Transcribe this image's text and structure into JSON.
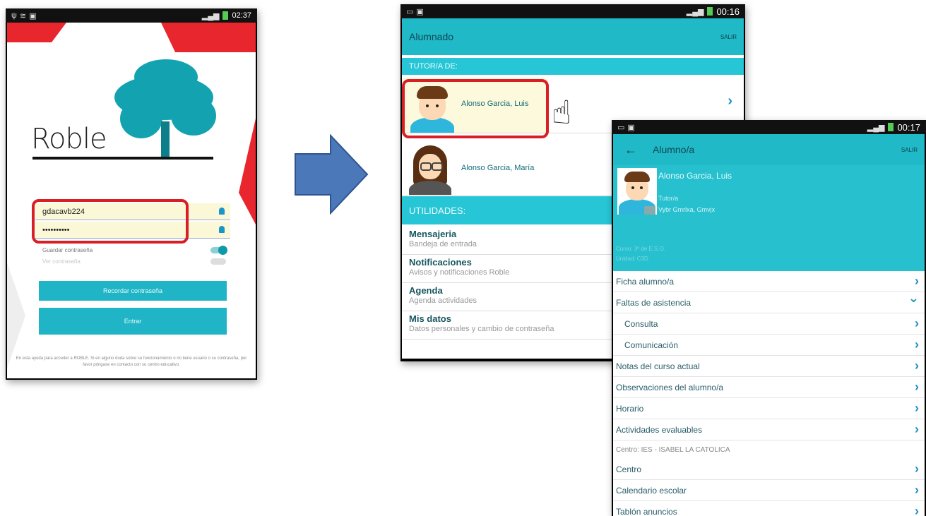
{
  "login": {
    "app_title": "Roble",
    "username_value": "gdacavb224",
    "password_value": "••••••••••",
    "save_password_label": "Guardar contraseña",
    "show_password_label": "Ver contraseña",
    "recover_button": "Recordar contraseña",
    "login_button": "Entrar",
    "footer": "En esta ayuda para acceder a ROBLE. Si en alguno duda sobre su funcionamiento o no tiene usuario o su contraseña, por favor póngase en contacto con su centro educativo.",
    "status_time": "02:37"
  },
  "alumnado": {
    "status_time": "00:16",
    "title": "Alumnado",
    "logout": "SALIR",
    "tutor_section": "TUTOR/A DE:",
    "students": [
      {
        "name": "Alonso Garcia, Luis"
      },
      {
        "name": "Alonso Garcia, María"
      }
    ],
    "utilities_section": "UTILIDADES:",
    "utilities": [
      {
        "title": "Mensajeria",
        "subtitle": "Bandeja de entrada"
      },
      {
        "title": "Notificaciones",
        "subtitle": "Avisos y notificaciones Roble"
      },
      {
        "title": "Agenda",
        "subtitle": "Agenda actividades"
      },
      {
        "title": "Mis datos",
        "subtitle": "Datos personales y cambio de contraseña"
      }
    ]
  },
  "alumno": {
    "status_time": "00:17",
    "title": "Alumno/a",
    "logout": "SALIR",
    "student_name": "Alonso Garcia, Luis",
    "tutor_label": "Tutor/a",
    "tutor_name": "Vybr Gmrlxa, Gmvjx",
    "course": "Curso: 3º de E.S.O.",
    "unit": "Unidad: C3D",
    "menu": [
      {
        "label": "Ficha alumno/a",
        "chevron": "›"
      },
      {
        "label": "Faltas de asistencia",
        "chevron": "⌄"
      },
      {
        "label": "Consulta",
        "chevron": "›"
      },
      {
        "label": "Comunicación",
        "chevron": "›"
      },
      {
        "label": "Notas del curso actual",
        "chevron": "›"
      },
      {
        "label": "Observaciones del alumno/a",
        "chevron": "›"
      },
      {
        "label": "Horario",
        "chevron": "›"
      },
      {
        "label": "Actividades evaluables",
        "chevron": "›"
      }
    ],
    "centro_line": "Centro: IES - ISABEL LA CATOLICA",
    "centro_menu": [
      {
        "label": "Centro",
        "chevron": "›"
      },
      {
        "label": "Calendario escolar",
        "chevron": "›"
      },
      {
        "label": "Tablón anuncios",
        "chevron": "›"
      }
    ]
  },
  "colors": {
    "teal": "#1fb9c8",
    "highlight_red": "#d81f26",
    "arrow_blue": "#4a78b8"
  }
}
